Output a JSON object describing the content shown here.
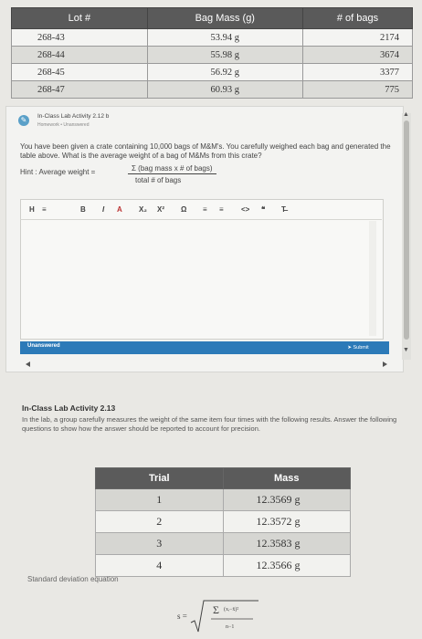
{
  "top_table": {
    "headers": [
      "Lot #",
      "Bag Mass (g)",
      "# of bags"
    ],
    "rows": [
      [
        "268-43",
        "53.94 g",
        "2174"
      ],
      [
        "268-44",
        "55.98 g",
        "3674"
      ],
      [
        "268-45",
        "56.92 g",
        "3377"
      ],
      [
        "268-47",
        "60.93 g",
        "775"
      ]
    ]
  },
  "question": {
    "title": "In-Class Lab Activity 2.12 b",
    "sub": "Homework • Unanswered",
    "text": "You have been given a crate containing 10,000 bags of M&M's. You carefully weighed each bag and generated the table above. What is the average weight of a bag of M&Ms from this crate?",
    "hint_label": "Hint : Average weight =",
    "hint_numerator": "Σ (bag mass x # of bags)",
    "hint_denominator": "total # of bags"
  },
  "editor": {
    "toolbar": [
      "H",
      "≡",
      "B",
      "I",
      "A",
      "X₂",
      "X²",
      "Ω",
      "≡",
      "≡",
      "<>",
      "❝",
      "T̶"
    ]
  },
  "status": {
    "label": "Unanswered",
    "submit": "Submit"
  },
  "activity": {
    "title": "In-Class Lab Activity 2.13",
    "text": "In the lab, a group carefully measures the weight of the same item four times with the following results. Answer the following questions to show how the answer should be reported to account for precision."
  },
  "trial_table": {
    "headers": [
      "Trial",
      "Mass"
    ],
    "rows": [
      [
        "1",
        "12.3569 g"
      ],
      [
        "2",
        "12.3572 g"
      ],
      [
        "3",
        "12.3583 g"
      ],
      [
        "4",
        "12.3566 g"
      ]
    ]
  },
  "sd": {
    "label": "Standard deviation equation",
    "s": "s ="
  },
  "colors": {
    "accent": "#2c7ab8",
    "header_dark": "#5a5a5a"
  }
}
